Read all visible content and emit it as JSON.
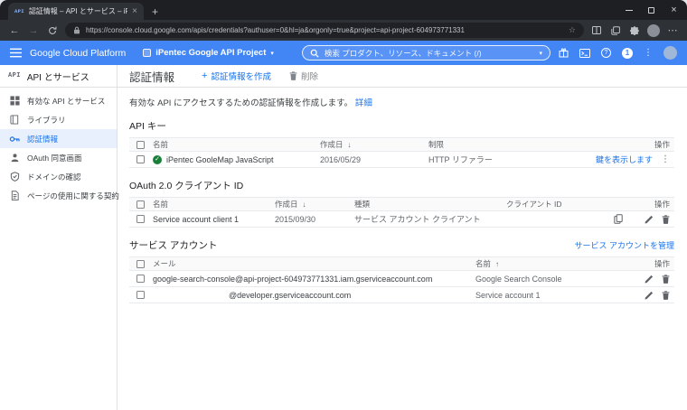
{
  "browser": {
    "tab_favicon_text": "API",
    "tab_title": "認証情報 – API とサービス – iPentec",
    "url": "https://console.cloud.google.com/apis/credentials?authuser=0&hl=ja&orgonly=true&project=api-project-604973771331"
  },
  "gcp_header": {
    "brand": "Google Cloud Platform",
    "project": "iPentec Google API Project",
    "search_placeholder": "検索 プロダクト、リソース、ドキュメント (/)",
    "notification_count": "1"
  },
  "sidebar": {
    "logo_text": "API",
    "title": "API とサービス",
    "items": [
      {
        "label": "有効な API とサービス"
      },
      {
        "label": "ライブラリ"
      },
      {
        "label": "認証情報"
      },
      {
        "label": "OAuth 同意画面"
      },
      {
        "label": "ドメインの確認"
      },
      {
        "label": "ページの使用に関する契約"
      }
    ]
  },
  "page": {
    "title": "認証情報",
    "create_label": "認証情報を作成",
    "delete_label": "削除",
    "intro_text": "有効な API にアクセスするための認証情報を作成します。",
    "intro_link": "詳細"
  },
  "api_keys": {
    "section_title": "API キー",
    "col_name": "名前",
    "col_created": "作成日",
    "col_restrictions": "制限",
    "col_actions": "操作",
    "rows": [
      {
        "name": "iPentec GooleMap JavaScript",
        "created": "2016/05/29",
        "restrictions": "HTTP リファラー",
        "action_link": "鍵を表示します"
      }
    ]
  },
  "oauth_clients": {
    "section_title": "OAuth 2.0 クライアント ID",
    "col_name": "名前",
    "col_created": "作成日",
    "col_type": "種類",
    "col_client_id": "クライアント ID",
    "col_actions": "操作",
    "rows": [
      {
        "name": "Service account client 1",
        "created": "2015/09/30",
        "type": "サービス アカウント クライアント"
      }
    ]
  },
  "service_accounts": {
    "section_title": "サービス アカウント",
    "manage_link": "サービス アカウントを管理",
    "col_email": "メール",
    "col_name": "名前",
    "col_actions": "操作",
    "rows": [
      {
        "email": "google-search-console@api-project-604973771331.iam.gserviceaccount.com",
        "name": "Google Search Console"
      },
      {
        "email": "@developer.gserviceaccount.com",
        "name": "Service account 1"
      }
    ]
  },
  "icons": {
    "back": "←",
    "forward": "→",
    "star": "☆",
    "close": "×",
    "plus": "+",
    "more_vertical": "⋮",
    "more_horizontal": "⋯",
    "caret_down": "▾",
    "help": "?",
    "check": "✓",
    "sort_down": "↓",
    "sort_up": "↑"
  },
  "colors": {
    "header_blue": "#4285f4",
    "link_blue": "#1a73e8",
    "check_green": "#188038",
    "active_item_bg": "#e8f0fe"
  }
}
